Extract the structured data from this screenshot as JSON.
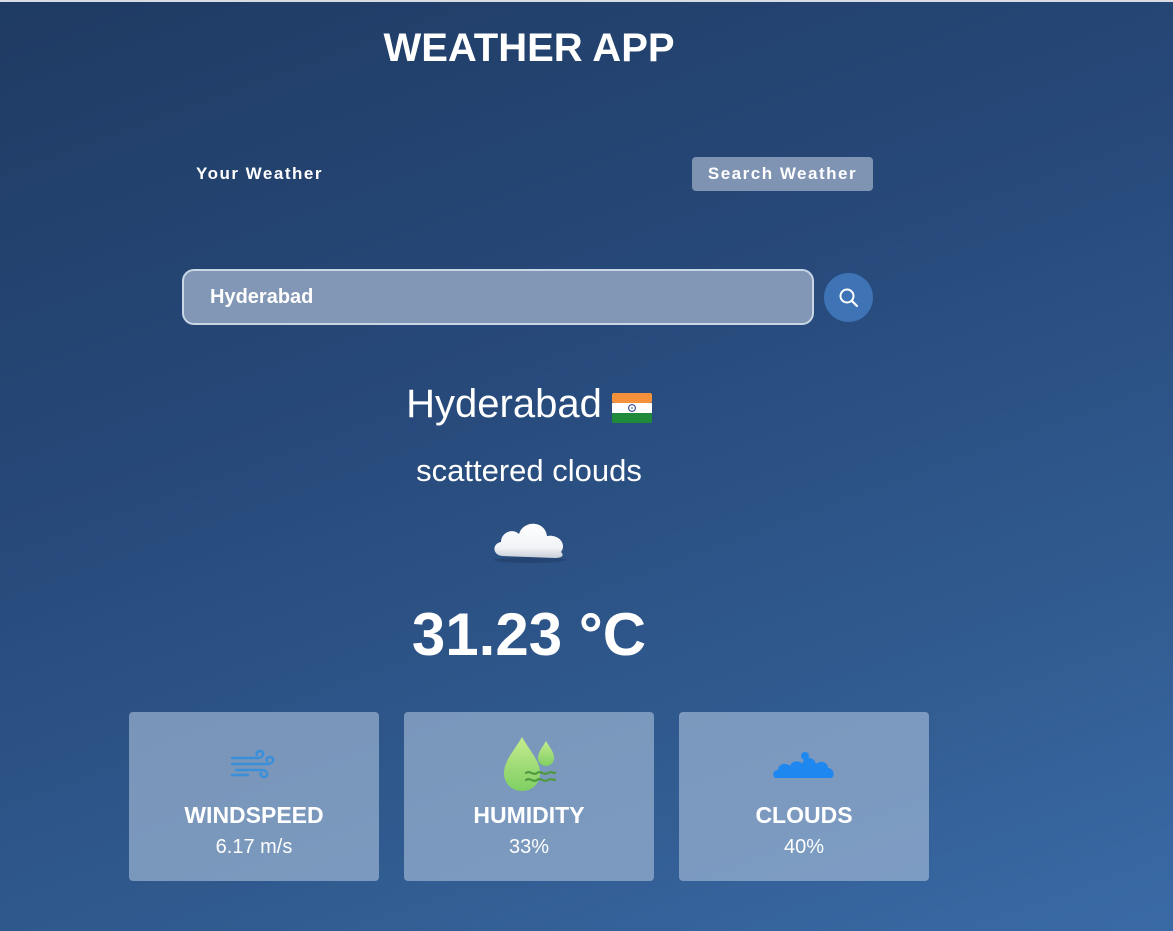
{
  "app": {
    "title": "WEATHER APP"
  },
  "tabs": [
    {
      "label": "Your Weather",
      "active": false
    },
    {
      "label": "Search Weather",
      "active": true
    }
  ],
  "search": {
    "value": "Hyderabad",
    "placeholder": "",
    "button_icon": "search-icon"
  },
  "weather": {
    "city": "Hyderabad",
    "flag_icon": "india-flag-icon",
    "description": "scattered clouds",
    "condition_icon": "cloud-icon",
    "temperature": "31.23 °C"
  },
  "cards": [
    {
      "icon": "wind-icon",
      "label": "WINDSPEED",
      "value": "6.17 m/s"
    },
    {
      "icon": "humidity-icon",
      "label": "HUMIDITY",
      "value": "33%"
    },
    {
      "icon": "clouds-icon",
      "label": "CLOUDS",
      "value": "40%"
    }
  ],
  "colors": {
    "background_top": "#1f3b63",
    "background_bottom": "#3a6aa6",
    "search_button": "#3e73b6",
    "card_bg": "#aabeda",
    "wind_icon": "#3a8fd9",
    "humidity_icon": "#a8e07a",
    "clouds_icon": "#1e88f0"
  }
}
